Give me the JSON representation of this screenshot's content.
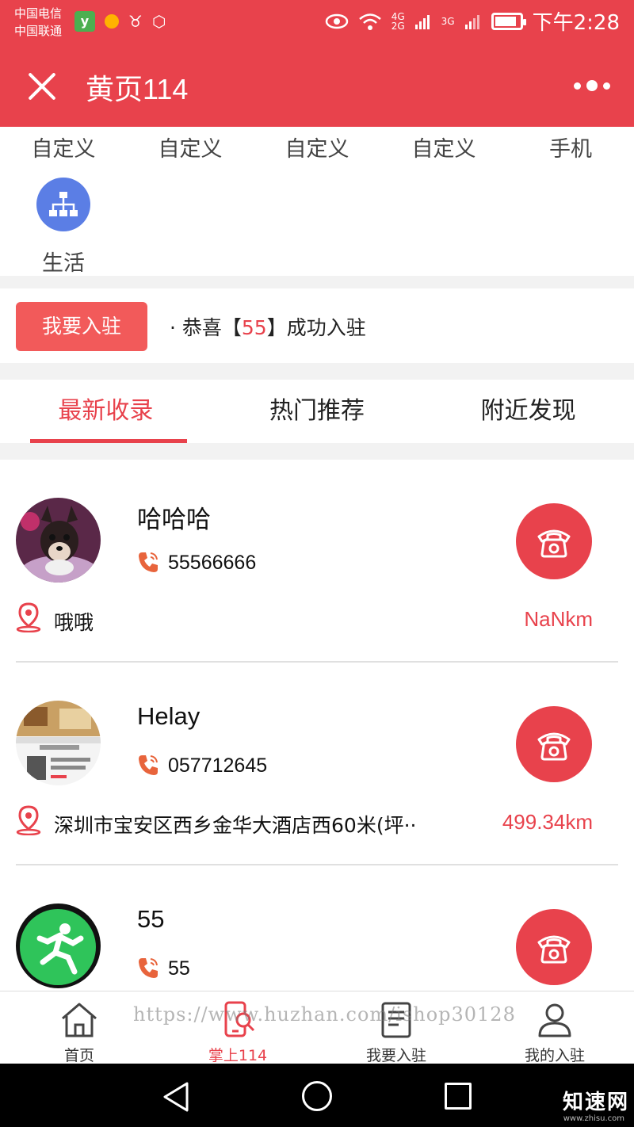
{
  "status_bar": {
    "carrier1": "中国电信",
    "carrier2": "中国联通",
    "net1": "4G",
    "net2": "2G",
    "net3": "3G",
    "time": "下午2:28",
    "icons": [
      "app-icon",
      "dot-icon",
      "cow-icon",
      "hex-icon",
      "eye-icon",
      "wifi-icon",
      "signal-icon",
      "battery-icon"
    ]
  },
  "nav": {
    "title": "黄页114",
    "close_icon": "close-icon",
    "more_icon": "more-icon"
  },
  "categories": {
    "items": [
      {
        "label": "自定义"
      },
      {
        "label": "自定义"
      },
      {
        "label": "自定义"
      },
      {
        "label": "自定义"
      },
      {
        "label": "手机"
      }
    ],
    "life": {
      "label": "生活",
      "icon": "org-chart-icon",
      "color": "#5b7ee5"
    }
  },
  "join": {
    "button_label": "我要入驻",
    "notice_prefix": "· 恭喜【",
    "notice_highlight": "55",
    "notice_suffix": "】成功入驻"
  },
  "tabs": [
    {
      "label": "最新收录",
      "active": true
    },
    {
      "label": "热门推荐",
      "active": false
    },
    {
      "label": "附近发现",
      "active": false
    }
  ],
  "listings": [
    {
      "name": "哈哈哈",
      "phone": "55566666",
      "address": "哦哦",
      "distance": "NaNkm"
    },
    {
      "name": "Helay",
      "phone": "057712645",
      "address": "深圳市宝安区西乡金华大酒店西60米(坪··",
      "distance": "499.34km"
    },
    {
      "name": "55",
      "phone": "55",
      "address": "",
      "distance": ""
    }
  ],
  "tabbar": [
    {
      "label": "首页",
      "icon": "home-icon",
      "active": false
    },
    {
      "label": "掌上114",
      "icon": "phone-search-icon",
      "active": true
    },
    {
      "label": "我要入驻",
      "icon": "document-icon",
      "active": false
    },
    {
      "label": "我的入驻",
      "icon": "user-icon",
      "active": false
    }
  ],
  "watermark": "https://www.huzhan.com/ishop30128",
  "corner_logo": "知速网",
  "corner_url": "www.zhisu.com",
  "colors": {
    "primary": "#e8424c",
    "accent_blue": "#5b7ee5",
    "phone_orange": "#e8643c"
  }
}
